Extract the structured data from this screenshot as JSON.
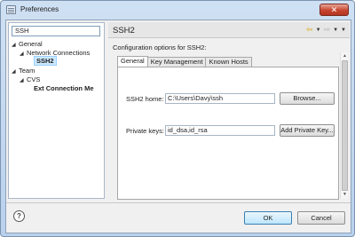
{
  "window": {
    "title": "Preferences",
    "close_glyph": "✕"
  },
  "sidebar": {
    "filter_value": "SSH",
    "tree": [
      {
        "label": "General",
        "arrow": "◢"
      },
      {
        "label": "Network Connections",
        "arrow": "◢"
      },
      {
        "label": "SSH2"
      },
      {
        "label": "Team",
        "arrow": "◢"
      },
      {
        "label": "CVS",
        "arrow": "◢"
      },
      {
        "label": "Ext Connection Me"
      }
    ]
  },
  "main": {
    "title": "SSH2",
    "nav": {
      "back": "⇦",
      "forward": "⇨",
      "dropdown": "▼"
    },
    "description": "Configuration options for SSH2:",
    "tabs": [
      "General",
      "Key Management",
      "Known Hosts"
    ],
    "ssh2_home": {
      "label": "SSH2 home:",
      "value": "C:\\Users\\Davy\\ssh",
      "button": "Browse..."
    },
    "private_keys": {
      "label": "Private keys:",
      "value": "id_dsa,id_rsa",
      "button": "Add Private Key..."
    }
  },
  "scrollbar": {
    "up": "▲",
    "down": "▼"
  },
  "footer": {
    "help": "?",
    "ok": "OK",
    "cancel": "Cancel"
  },
  "colors": {
    "accent": "#3c7fb1",
    "selection": "#cce8ff",
    "close": "#c6452f"
  }
}
